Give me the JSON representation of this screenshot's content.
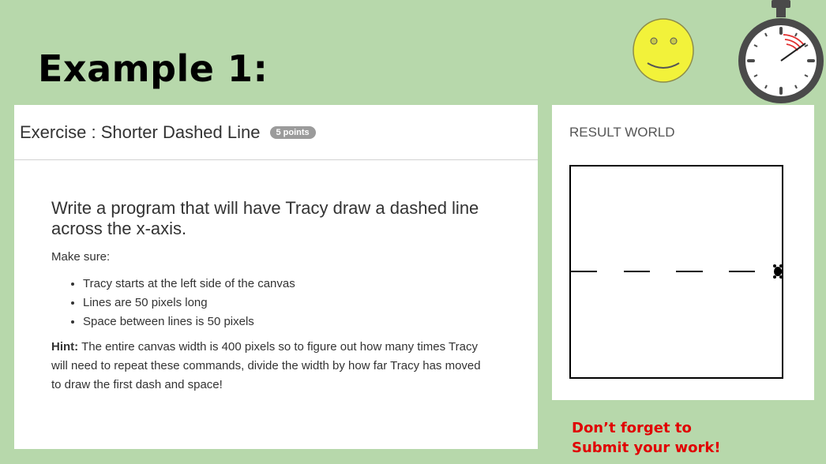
{
  "slide": {
    "title": "Example 1:"
  },
  "exercise": {
    "title": "Exercise : Shorter Dashed Line",
    "points_badge": "5 points",
    "prompt": "Write a program that will have Tracy draw a dashed line across the x-axis.",
    "make_sure": "Make sure:",
    "requirements": [
      "Tracy starts at the left side of the canvas",
      "Lines are 50 pixels long",
      "Space between lines is 50 pixels"
    ],
    "hint_label": "Hint:",
    "hint_text": "The entire canvas width is 400 pixels so to figure out how many times Tracy will need to repeat these commands, divide the width by how far Tracy has moved to draw the first dash and space!"
  },
  "result": {
    "label": "RESULT WORLD"
  },
  "reminder": {
    "line1": "Don’t forget to",
    "line2": "Submit your work!"
  },
  "icons": {
    "smiley": "smiley-face-icon",
    "stopwatch": "stopwatch-icon",
    "turtle": "turtle-icon"
  },
  "colors": {
    "background": "#b7d8ab",
    "smiley": "#f2f23a",
    "reminder": "#e00000",
    "stopwatch": "#4a4a4a"
  }
}
